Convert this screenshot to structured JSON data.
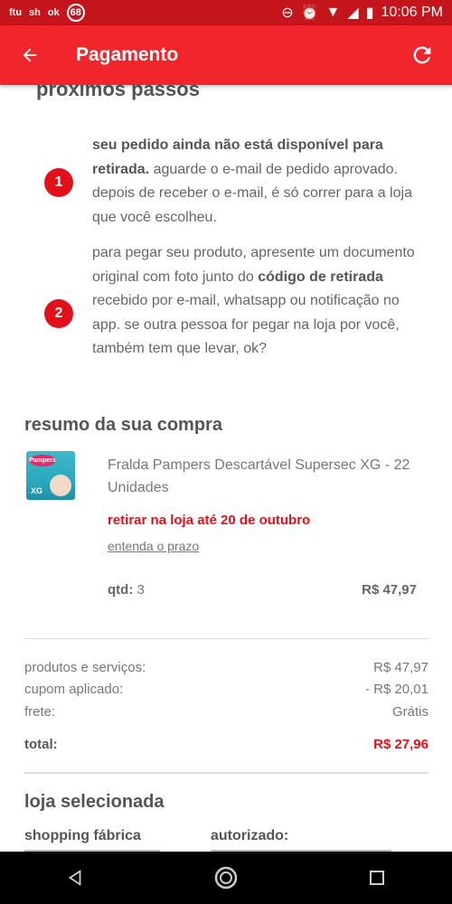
{
  "status_bar": {
    "left_items": [
      "ftu",
      "sh",
      "ok"
    ],
    "notification_count": "68",
    "time": "10:06 PM"
  },
  "app_bar": {
    "title": "Pagamento"
  },
  "next_steps": {
    "title": "proximos passos",
    "steps": [
      {
        "number": "1",
        "bold_text": "seu pedido ainda não está disponível para retirada.",
        "text": " aguarde o e-mail de pedido aprovado. depois de receber o e-mail, é só correr para a loja que você escolheu."
      },
      {
        "number": "2",
        "text_before": "para pegar seu produto, apresente um documento original com foto junto do ",
        "bold_text": "código de retirada",
        "text_after": " recebido por e-mail, whatsapp ou notificação no app. se outra pessoa for pegar na loja por você, também tem que levar, ok?"
      }
    ]
  },
  "summary": {
    "title": "resumo da sua compra",
    "product": {
      "image_brand": "Pampers",
      "image_size": "XG",
      "name": "Fralda Pampers Descartável Supersec XG - 22 Unidades",
      "pickup_text": "retirar na loja até 20 de outubro",
      "deadline_link": "entenda o prazo",
      "qty_label": "qtd:",
      "qty_value": "3",
      "price": "R$ 47,97"
    }
  },
  "totals": {
    "rows": [
      {
        "label": "produtos e serviços:",
        "value": "R$ 47,97"
      },
      {
        "label": "cupom aplicado:",
        "value": "- R$ 20,01"
      },
      {
        "label": "frete:",
        "value": "Grátis"
      }
    ],
    "total_label": "total:",
    "total_value": "R$ 27,96"
  },
  "store": {
    "title": "loja selecionada",
    "store_name": "shopping fábrica",
    "authorized_label": "autorizado:"
  },
  "colors": {
    "status_bar": "#c4141c",
    "app_bar": "#f1262d",
    "accent_red": "#e2101a"
  }
}
